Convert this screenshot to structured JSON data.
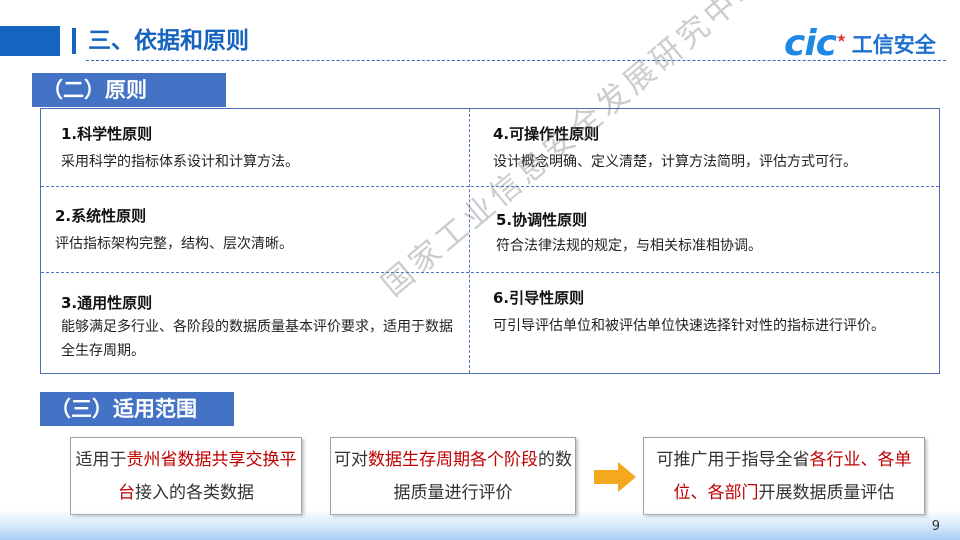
{
  "header": {
    "title": "三、依据和原则",
    "logo_cic": "cic",
    "logo_text": "工信安全"
  },
  "section_principles": {
    "title": "（二）原则",
    "items": [
      {
        "title": "1.科学性原则",
        "desc": "采用科学的指标体系设计和计算方法。"
      },
      {
        "title": "2.系统性原则",
        "desc": "评估指标架构完整，结构、层次清晰。"
      },
      {
        "title": "3.通用性原则",
        "desc": "能够满足多行业、各阶段的数据质量基本评价要求，适用于数据全生存周期。"
      },
      {
        "title": "4.可操作性原则",
        "desc": "设计概念明确、定义清楚，计算方法简明，评估方式可行。"
      },
      {
        "title": "5.协调性原则",
        "desc": "符合法律法规的规定，与相关标准相协调。"
      },
      {
        "title": "6.引导性原则",
        "desc": "可引导评估单位和被评估单位快速选择针对性的指标进行评价。"
      }
    ]
  },
  "section_scope": {
    "title": "（三）适用范围",
    "box1": {
      "pre": "适用于",
      "highlight": "贵州省数据共享交换平台",
      "post": "接入的各类数据"
    },
    "box2": {
      "pre": "可对",
      "highlight": "数据生存周期各个阶段",
      "post": "的数据质量进行评价"
    },
    "box3": {
      "pre": "可推广用于指导全省",
      "highlight": "各行业、各单位、各部门",
      "post": "开展数据质量评估"
    }
  },
  "watermark": "国家工业信息安全发展研究中心",
  "page_number": "9",
  "colors": {
    "accent": "#1565c0",
    "section_bg": "#4472c4",
    "highlight": "#c00000",
    "arrow": "#f4a81d"
  }
}
